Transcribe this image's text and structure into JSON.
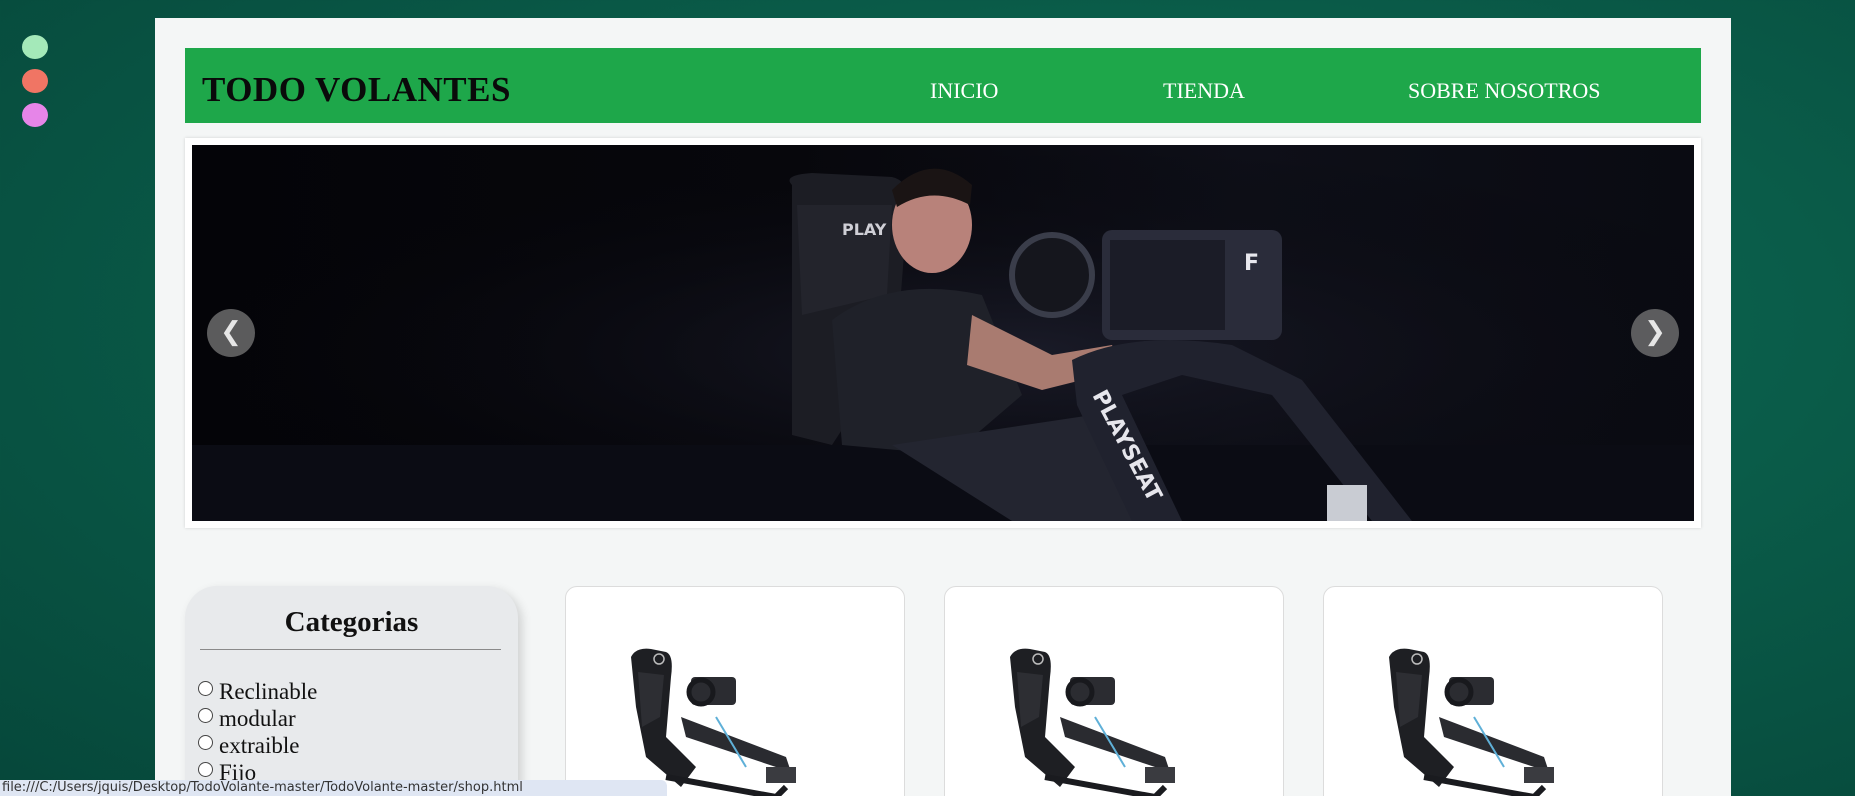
{
  "window_dots": [
    {
      "color": "#a4e9b9"
    },
    {
      "color": "#f07564"
    },
    {
      "color": "#e685e8"
    }
  ],
  "header": {
    "brand": "TODO VOLANTES",
    "nav": [
      "INICIO",
      "TIENDA",
      "SOBRE NOSOTROS"
    ],
    "background": "#1ea74a"
  },
  "carousel": {
    "image": "man-driving-racing-simulator-photo",
    "prev_icon": "chevron-left-icon",
    "next_icon": "chevron-right-icon",
    "prev_glyph": "❮",
    "next_glyph": "❯"
  },
  "sidebar": {
    "title": "Categorias",
    "categories": [
      "Reclinable",
      "modular",
      "extraible",
      "Fijo"
    ]
  },
  "products": [
    {
      "image": "racing-cockpit-seat-photo"
    },
    {
      "image": "racing-cockpit-seat-photo"
    },
    {
      "image": "racing-cockpit-seat-photo"
    }
  ],
  "statusbar": {
    "url": "file:///C:/Users/jquis/Desktop/TodoVolante-master/TodoVolante-master/shop.html"
  }
}
